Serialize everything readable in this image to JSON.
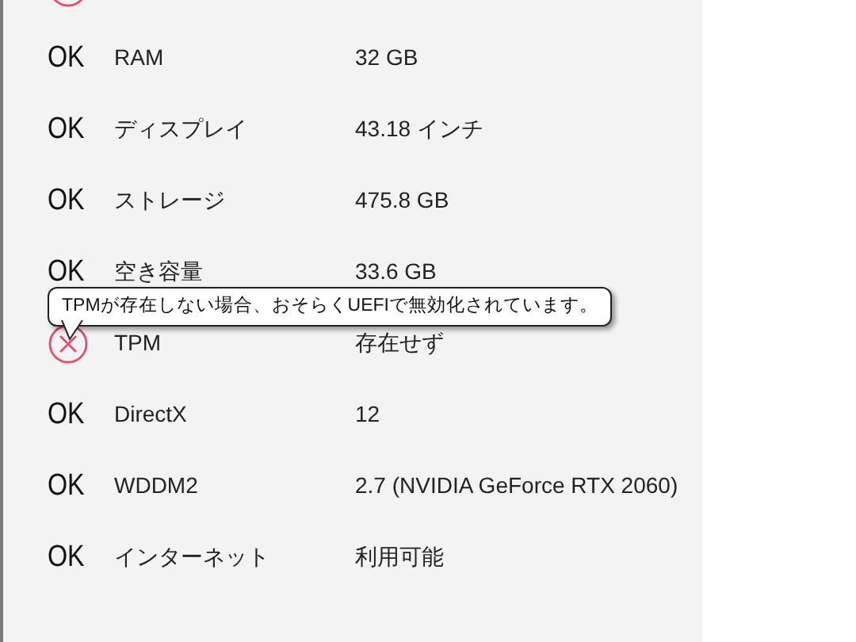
{
  "rows": [
    {
      "kind": "fail"
    },
    {
      "kind": "ok",
      "status_text": "OK",
      "label": "RAM",
      "value": "32 GB"
    },
    {
      "kind": "ok",
      "status_text": "OK",
      "label": "ディスプレイ",
      "value": "43.18 インチ"
    },
    {
      "kind": "ok",
      "status_text": "OK",
      "label": "ストレージ",
      "value": "475.8 GB"
    },
    {
      "kind": "ok",
      "status_text": "OK",
      "label": "空き容量",
      "value": "33.6 GB"
    },
    {
      "kind": "fail",
      "label": "TPM",
      "value": "存在せず"
    },
    {
      "kind": "ok",
      "status_text": "OK",
      "label": "DirectX",
      "value": "12"
    },
    {
      "kind": "ok",
      "status_text": "OK",
      "label": "WDDM2",
      "value": "2.7 (NVIDIA GeForce RTX 2060)"
    },
    {
      "kind": "ok",
      "status_text": "OK",
      "label": "インターネット",
      "value": "利用可能"
    }
  ],
  "tooltip": {
    "text": "TPMが存在しない場合、おそらくUEFIで無効化されています。"
  }
}
